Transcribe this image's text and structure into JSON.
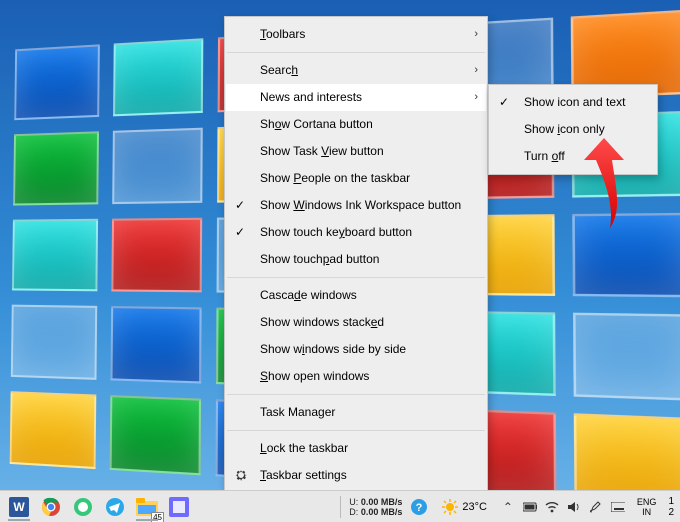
{
  "menu": {
    "items": [
      {
        "label": "Toolbars",
        "submenu": true,
        "underlineChar": "T"
      },
      {
        "sep": true
      },
      {
        "label": "Search",
        "submenu": true,
        "underlineChar": "h"
      },
      {
        "label": "News and interests",
        "submenu": true,
        "hovered": true
      },
      {
        "label": "Show Cortana button",
        "underlineChar": "o"
      },
      {
        "label": "Show Task View button",
        "underlineChar": "V"
      },
      {
        "label": "Show People on the taskbar",
        "underlineChar": "P"
      },
      {
        "label": "Show Windows Ink Workspace button",
        "checked": true,
        "underlineChar": "W"
      },
      {
        "label": "Show touch keyboard button",
        "checked": true,
        "underlineChar": "y"
      },
      {
        "label": "Show touchpad button",
        "underlineChar": "p"
      },
      {
        "sep": true
      },
      {
        "label": "Cascade windows",
        "underlineChar": "d"
      },
      {
        "label": "Show windows stacked",
        "underlineChar": "e"
      },
      {
        "label": "Show windows side by side",
        "underlineChar": "i"
      },
      {
        "label": "Show open windows",
        "underlineChar": "S"
      },
      {
        "sep": true
      },
      {
        "label": "Task Manager",
        "underlineChar": "K"
      },
      {
        "sep": true
      },
      {
        "label": "Lock the taskbar",
        "underlineChar": "L"
      },
      {
        "label": "Taskbar settings",
        "icon": "gear",
        "underlineChar": "T"
      }
    ]
  },
  "submenu": {
    "items": [
      {
        "label": "Show icon and text",
        "checked": true
      },
      {
        "label": "Show icon only",
        "underlineChar": "i"
      },
      {
        "label": "Turn off",
        "underlineChar": "o"
      }
    ]
  },
  "taskbar": {
    "badge": "45",
    "net": {
      "u_label": "U:",
      "u_val": "0.00 MB/s",
      "d_label": "D:",
      "d_val": "0.00 MB/s"
    },
    "weather": {
      "temp": "23°C",
      "icon": "sun"
    },
    "lang": {
      "l1": "ENG",
      "l2": "IN"
    },
    "clock": {
      "time": "1",
      "date": "2"
    }
  }
}
